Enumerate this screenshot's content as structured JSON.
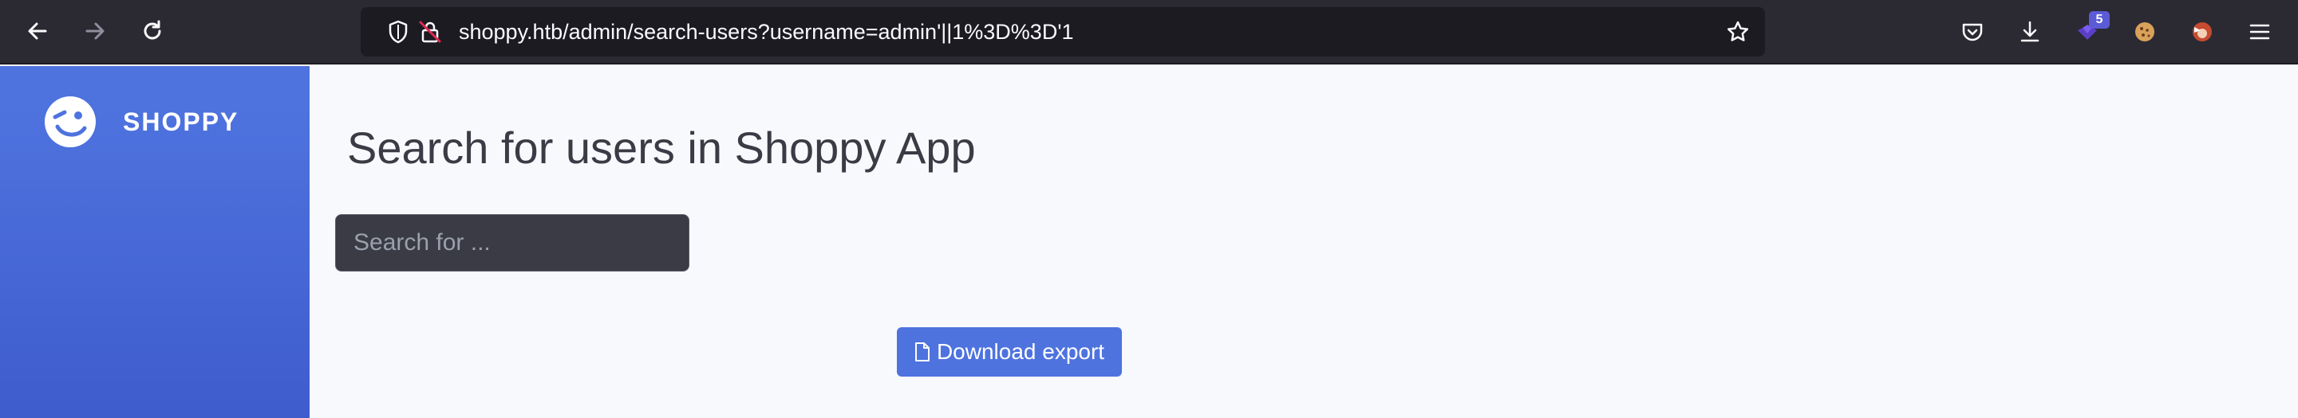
{
  "browser": {
    "url": "shoppy.htb/admin/search-users?username=admin'||1%3D%3D'1",
    "extension_badge": "5"
  },
  "sidebar": {
    "brand": "SHOPPY"
  },
  "main": {
    "title": "Search for users in Shoppy App",
    "search_placeholder": "Search for ...",
    "download_button": "Download export"
  },
  "colors": {
    "accent": "#4e73df",
    "toolbar": "#2b2a33",
    "urlbar": "#1c1b22"
  }
}
